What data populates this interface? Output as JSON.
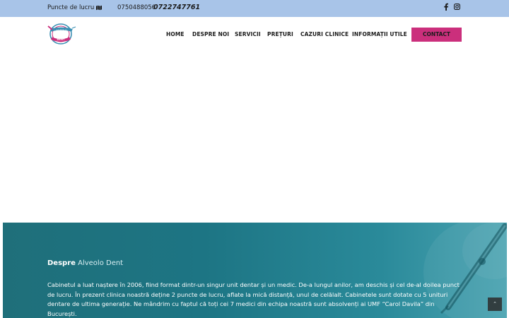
{
  "topbar": {
    "locations_label": "Puncte de lucru",
    "phone_primary": "0750488056",
    "phone_secondary": "0722747761"
  },
  "brand": {
    "logo_text_top": "ALVEOLO",
    "logo_text_bottom": "DENT"
  },
  "nav": {
    "items": [
      "HOME",
      "DESPRE NOI",
      "SERVICII",
      "PREȚURI",
      "CAZURI CLINICE",
      "INFORMAȚII UTILE"
    ],
    "contact_label": "CONTACT"
  },
  "about": {
    "title_prefix": "Despre",
    "title_brand": "Alveolo Dent",
    "paragraph": "Cabinetul a luat naștere în 2006, fiind format dintr-un singur unit dentar și un medic. De-a lungul anilor, am deschis și cel de-al doilea punct de lucru. În prezent clinica noastră deține 2 puncte de lucru, aflate la mică distanță, unul de celălalt. Cabinetele sunt dotate cu 5 unituri dentare de ultima generație. Ne mândrim cu faptul că toți cei 7 medici din echipa noastră sunt absolvenți ai UMF “Carol Davila” din București."
  },
  "colors": {
    "topbar": "#a8c4e8",
    "accent": "#cb2f7c",
    "teal": "#1d7584"
  },
  "scroll_top_label": "⌃"
}
